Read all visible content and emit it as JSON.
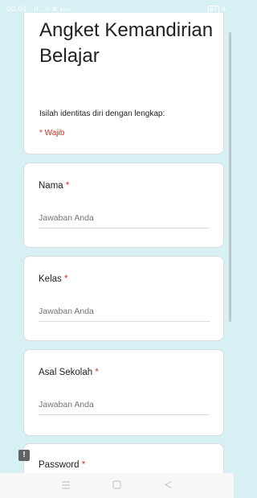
{
  "status_bar": {
    "time": "00.01",
    "signal": "..ıl ..ıl",
    "wifi": "≋",
    "speed": "KB/s",
    "more": "···",
    "battery": "87"
  },
  "form": {
    "title": "Angket Kemandirian Belajar",
    "description": "Isilah identitas diri dengan lengkap:",
    "required_note": "* Wajib"
  },
  "questions": [
    {
      "label": "Nama",
      "required_mark": "*",
      "placeholder": "Jawaban Anda",
      "value": ""
    },
    {
      "label": "Kelas",
      "required_mark": "*",
      "placeholder": "Jawaban Anda",
      "value": ""
    },
    {
      "label": "Asal Sekolah",
      "required_mark": "*",
      "placeholder": "Jawaban Anda",
      "value": ""
    },
    {
      "label": "Password",
      "required_mark": "*"
    }
  ],
  "feedback_icon": "!",
  "colors": {
    "background": "#d6f0f4",
    "required": "#d93025",
    "text": "#202124",
    "placeholder": "#70757a"
  },
  "icons": {
    "nav_menu": "menu-icon",
    "nav_home": "home-icon",
    "nav_back": "back-icon",
    "feedback": "report-icon"
  }
}
